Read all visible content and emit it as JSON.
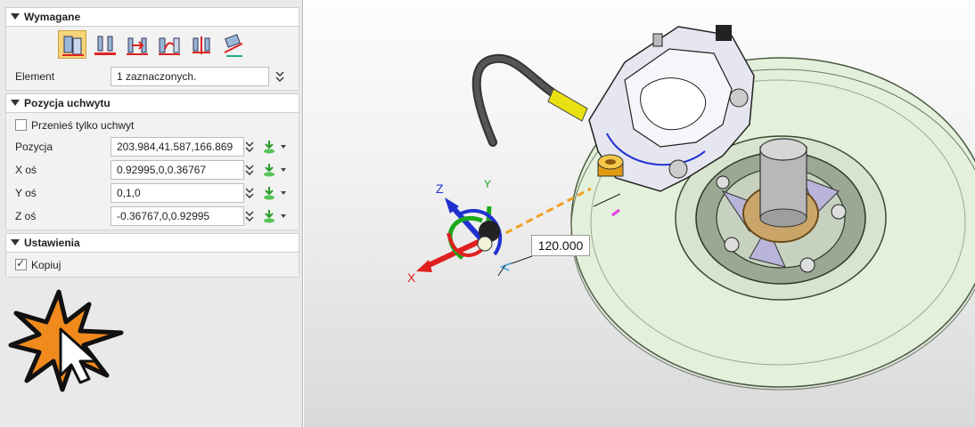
{
  "panel": {
    "required": {
      "title": "Wymagane",
      "icons": [
        "align-plane-icon",
        "align-axis-icon",
        "move-along-icon",
        "move-direction-icon",
        "move-point-icon",
        "move-dynamic-icon"
      ],
      "element_label": "Element",
      "element_value": "1 zaznaczonych."
    },
    "handle_position": {
      "title": "Pozycja uchwytu",
      "move_handle_only_label": "Przenieś tylko uchwyt",
      "move_handle_only_checked": false,
      "position_label": "Pozycja",
      "position_value": "203.984,41.587,166.869",
      "x_axis_label": "X oś",
      "x_axis_value": "0.92995,0,0.36767",
      "y_axis_label": "Y oś",
      "y_axis_value": "0,1,0",
      "z_axis_label": "Z oś",
      "z_axis_value": "-0.36767,0,0.92995"
    },
    "settings": {
      "title": "Ustawienia",
      "copy_label": "Kopiuj",
      "copy_checked": true
    }
  },
  "viewport": {
    "dimension_value": "120.000",
    "triad": {
      "x": "X",
      "y": "Y",
      "z": "Z"
    }
  },
  "colors": {
    "accent_active": "#f6d57a",
    "axis_x": "#e02020",
    "axis_y": "#1aa81a",
    "axis_z": "#2030d0",
    "dimension_line": "#f0a020",
    "disc": "#e3f0dc"
  }
}
